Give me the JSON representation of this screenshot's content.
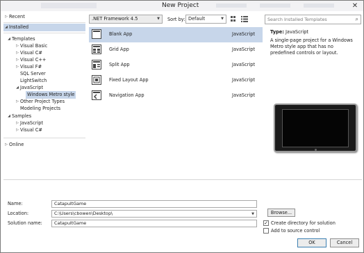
{
  "window": {
    "title": "New Project"
  },
  "tree": {
    "recent": "Recent",
    "installed": "Installed",
    "templates": "Templates",
    "visual_basic": "Visual Basic",
    "visual_csharp": "Visual C#",
    "visual_cpp": "Visual C++",
    "visual_fsharp": "Visual F#",
    "sql_server": "SQL Server",
    "lightswitch": "LightSwitch",
    "javascript": "JavaScript",
    "windows_metro_style": "Windows Metro style",
    "other_project_types": "Other Project Types",
    "modeling_projects": "Modeling Projects",
    "samples": "Samples",
    "samples_javascript": "JavaScript",
    "samples_csharp": "Visual C#",
    "online": "Online"
  },
  "toolbar": {
    "framework": ".NET Framework 4.5",
    "sort_by_label": "Sort by:",
    "sort_value": "Default",
    "search_placeholder": "Search Installed Templates"
  },
  "templates": [
    {
      "name": "Blank App",
      "language": "JavaScript",
      "icon": "blank-app-icon",
      "selected": true
    },
    {
      "name": "Grid App",
      "language": "JavaScript",
      "icon": "grid-app-icon",
      "selected": false
    },
    {
      "name": "Split App",
      "language": "JavaScript",
      "icon": "split-app-icon",
      "selected": false
    },
    {
      "name": "Fixed Layout App",
      "language": "JavaScript",
      "icon": "fixed-layout-app-icon",
      "selected": false
    },
    {
      "name": "Navigation App",
      "language": "JavaScript",
      "icon": "navigation-app-icon",
      "selected": false
    }
  ],
  "details": {
    "type_label": "Type:",
    "type_value": "JavaScript",
    "description": "A single-page project for a Windows Metro style app that has no predefined controls or layout."
  },
  "form": {
    "name_label": "Name:",
    "name_value": "CatapultGame",
    "location_label": "Location:",
    "location_value": "C:\\Users\\cbowen\\Desktop\\",
    "solution_label": "Solution name:",
    "solution_value": "CatapultGame",
    "browse_label": "Browse...",
    "create_dir_label": "Create directory for solution",
    "create_dir_checked": true,
    "source_control_label": "Add to source control",
    "source_control_checked": false
  },
  "buttons": {
    "ok": "OK",
    "cancel": "Cancel"
  },
  "colors": {
    "selection": "#c7d6ea",
    "accent": "#3c7fb1"
  }
}
